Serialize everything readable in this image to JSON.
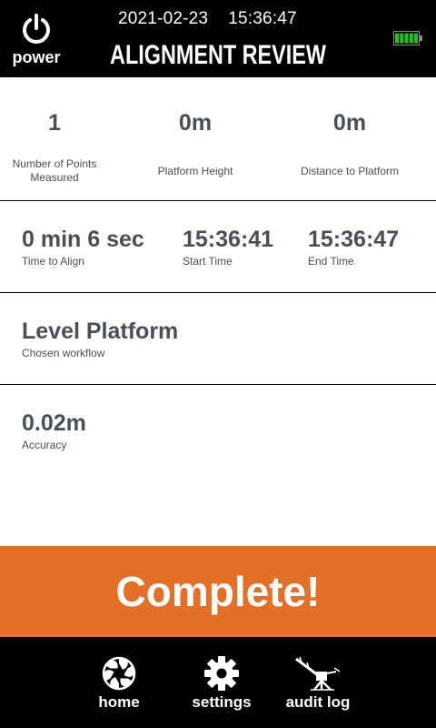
{
  "header": {
    "date": "2021-02-23",
    "time": "15:36:47",
    "title": "ALIGNMENT REVIEW",
    "power_label": "power",
    "battery_level": 1.0,
    "battery_color": "#22c020"
  },
  "stats": {
    "points_value": "1",
    "points_label": "Number of Points Measured",
    "height_value": "0m",
    "height_label": "Platform Height",
    "distance_value": "0m",
    "distance_label": "Distance to Platform"
  },
  "timing": {
    "duration_value": "0 min 6 sec",
    "duration_label": "Time to Align",
    "start_value": "15:36:41",
    "start_label": "Start Time",
    "end_value": "15:36:47",
    "end_label": "End Time"
  },
  "workflow": {
    "value": "Level Platform",
    "label": "Chosen workflow"
  },
  "accuracy": {
    "value": "0.02m",
    "label": "Accuracy"
  },
  "complete": {
    "label": "Complete!",
    "color": "#e37026"
  },
  "nav": {
    "home_label": "home",
    "home_icon": "aperture-icon",
    "settings_label": "settings",
    "settings_icon": "gear-icon",
    "audit_label": "audit log",
    "audit_icon": "turret-icon"
  }
}
